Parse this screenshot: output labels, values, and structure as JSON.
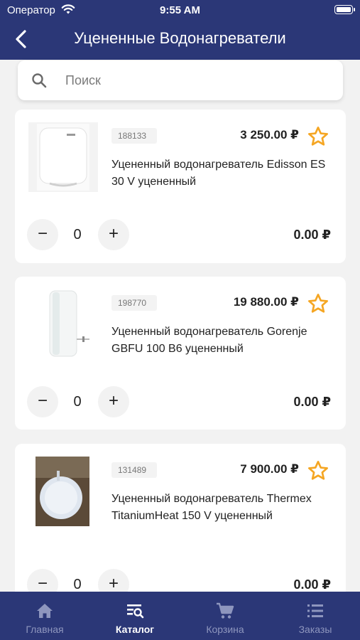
{
  "status_bar": {
    "carrier": "Оператор",
    "time": "9:55 AM"
  },
  "header": {
    "title": "Уцененные Водонагреватели"
  },
  "search": {
    "placeholder": "Поиск",
    "value": ""
  },
  "colors": {
    "brand": "#2b3777",
    "star": "#f5a623",
    "background": "#f2f2f2"
  },
  "products": [
    {
      "sku": "188133",
      "price": "3 250.00 ₽",
      "name": "Уцененный водонагреватель Edisson ES 30 V уцененный",
      "minus": "−",
      "qty": "0",
      "plus": "+",
      "total": "0.00 ₽"
    },
    {
      "sku": "198770",
      "price": "19 880.00 ₽",
      "name": "Уцененный водонагреватель Gorenje GBFU 100 B6 уцененный",
      "minus": "−",
      "qty": "0",
      "plus": "+",
      "total": "0.00 ₽"
    },
    {
      "sku": "131489",
      "price": "7 900.00 ₽",
      "name": "Уцененный водонагреватель Thermex TitaniumHeat 150 V уцененный",
      "minus": "−",
      "qty": "0",
      "plus": "+",
      "total": "0.00 ₽"
    }
  ],
  "tabbar": {
    "items": [
      {
        "label": "Главная",
        "icon": "home-icon"
      },
      {
        "label": "Каталог",
        "icon": "catalog-search-icon",
        "active": true
      },
      {
        "label": "Корзина",
        "icon": "cart-icon"
      },
      {
        "label": "Заказы",
        "icon": "list-icon"
      }
    ]
  }
}
